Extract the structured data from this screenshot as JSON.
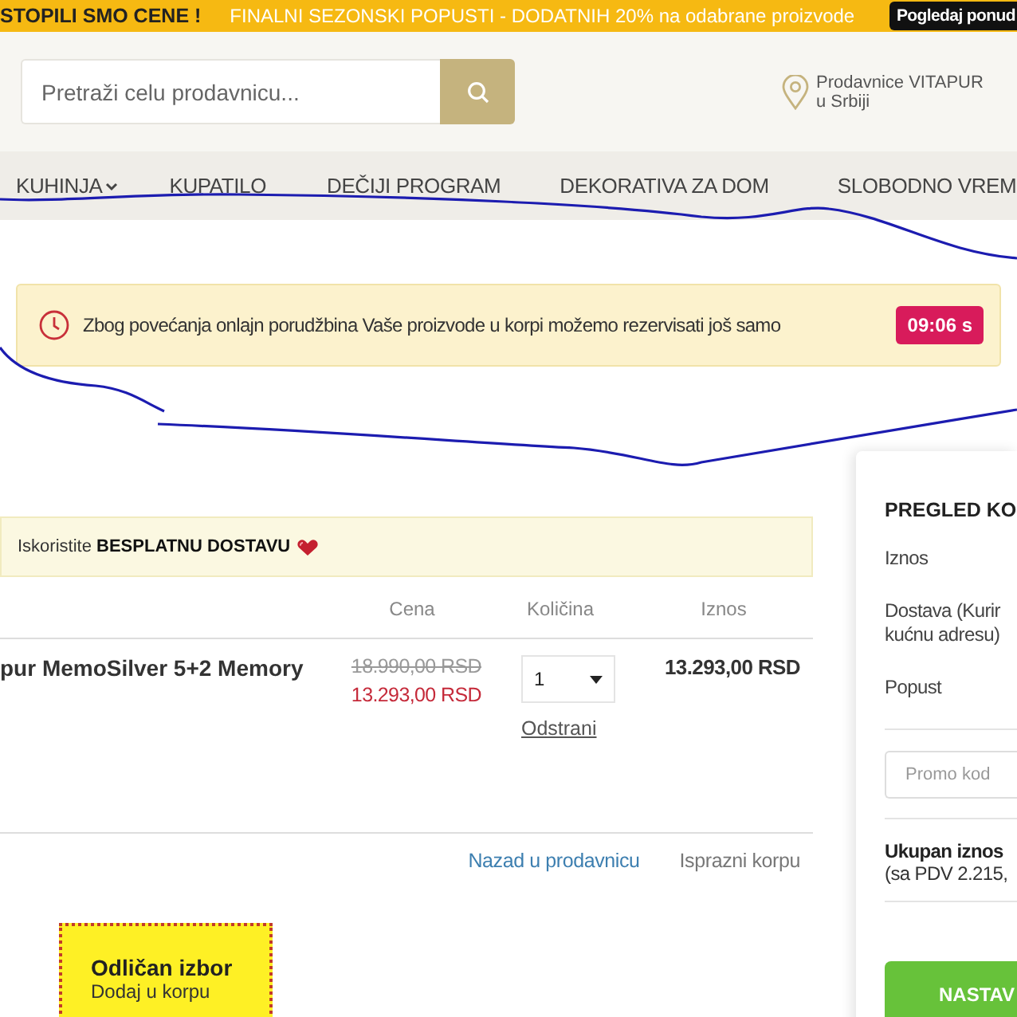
{
  "promo_bar": {
    "headline": "STOPILI SMO CENE !",
    "message": "FINALNI SEZONSKI POPUSTI - DODATNIH 20% na odabrane proizvode",
    "button": "Pogledaj ponud"
  },
  "search": {
    "placeholder": "Pretraži celu prodavnicu..."
  },
  "stores_link": {
    "line_1": "Prodavnice VITAPUR",
    "line_2": "u Srbiji"
  },
  "nav": [
    {
      "label": "KUHINJA",
      "has_dropdown": true
    },
    {
      "label": "KUPATILO",
      "has_dropdown": false
    },
    {
      "label": "DEČIJI PROGRAM",
      "has_dropdown": false
    },
    {
      "label": "DEKORATIVA ZA DOM",
      "has_dropdown": false
    },
    {
      "label": "SLOBODNO VREM",
      "has_dropdown": false
    }
  ],
  "reservation_alert": {
    "text": "Zbog povećanja onlajn porudžbina Vaše proizvode u korpi možemo rezervisati još samo",
    "timer": "09:06 s"
  },
  "free_delivery": {
    "text": "Iskoristite **BESPLATNU DOSTAVU**"
  },
  "cart": {
    "columns": [
      "Cena",
      "Količina",
      "Iznos"
    ],
    "rows": [
      {
        "product": "pur MemoSilver 5+2 Memory",
        "old_price": "18.990,00 RSD",
        "price": "13.293,00 RSD",
        "quantity": "1",
        "remove": "Odstrani",
        "total": "13.293,00 RSD"
      }
    ],
    "links": [
      "Nazad u prodavnicu",
      "Isprazni korpu"
    ]
  },
  "upsell": {
    "title": "Odličan izbor",
    "subtitle": "Dodaj u korpu"
  },
  "summary": {
    "title": "PREGLED KO",
    "lines": [
      "Iznos",
      "Dostava (Kurir kućnu adresu)",
      "Popust"
    ],
    "promo_placeholder": "Promo kod",
    "total_label": "Ukupan iznos",
    "total_note": "(sa PDV 2.215,",
    "button": "NASTAV"
  }
}
